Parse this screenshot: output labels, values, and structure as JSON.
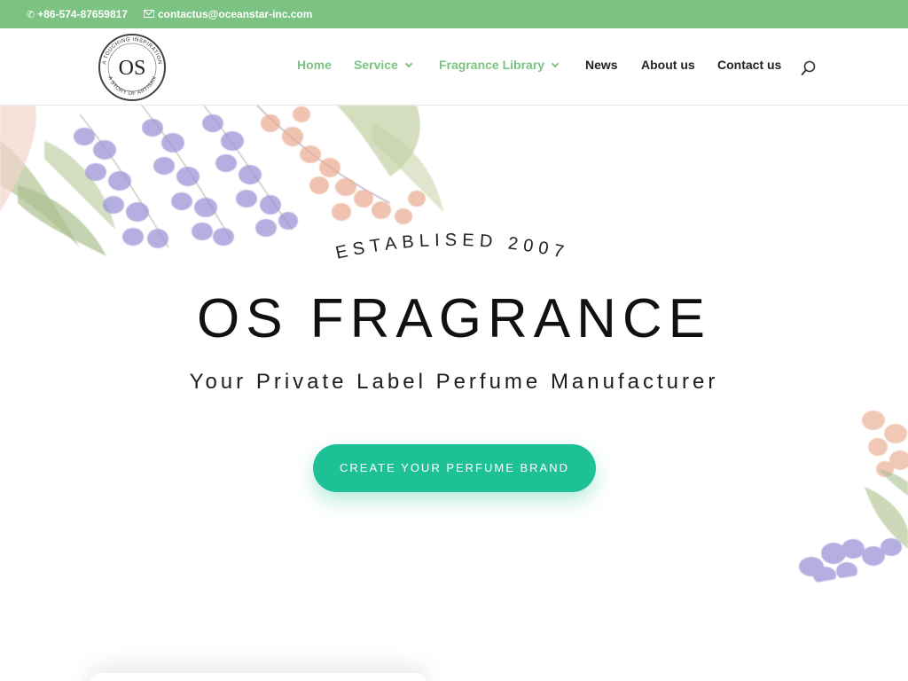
{
  "topbar": {
    "phone": "+86-574-87659817",
    "email": "contactus@oceanstar-inc.com",
    "phone_icon": "phone-icon",
    "email_icon": "envelope-icon",
    "background": "#7cc383"
  },
  "header": {
    "logo": {
      "monogram": "OS",
      "ring_top": "A TOUCHING INSPIRATION",
      "ring_bottom": "A STORY OF ARTISAN"
    },
    "nav": [
      {
        "label": "Home",
        "has_dropdown": false
      },
      {
        "label": "Service",
        "has_dropdown": true
      },
      {
        "label": "Fragrance Library",
        "has_dropdown": true
      },
      {
        "label": "News",
        "has_dropdown": false
      },
      {
        "label": "About us",
        "has_dropdown": false
      },
      {
        "label": "Contact us",
        "has_dropdown": false
      }
    ],
    "search_icon": "search-icon",
    "accent": "#7cc383"
  },
  "hero": {
    "established": "ESTABLISED 2007",
    "title": "OS FRAGRANCE",
    "subtitle": "Your Private Label Perfume Manufacturer",
    "cta": "CREATE YOUR PERFUME BRAND",
    "cta_color": "#1ec196"
  }
}
